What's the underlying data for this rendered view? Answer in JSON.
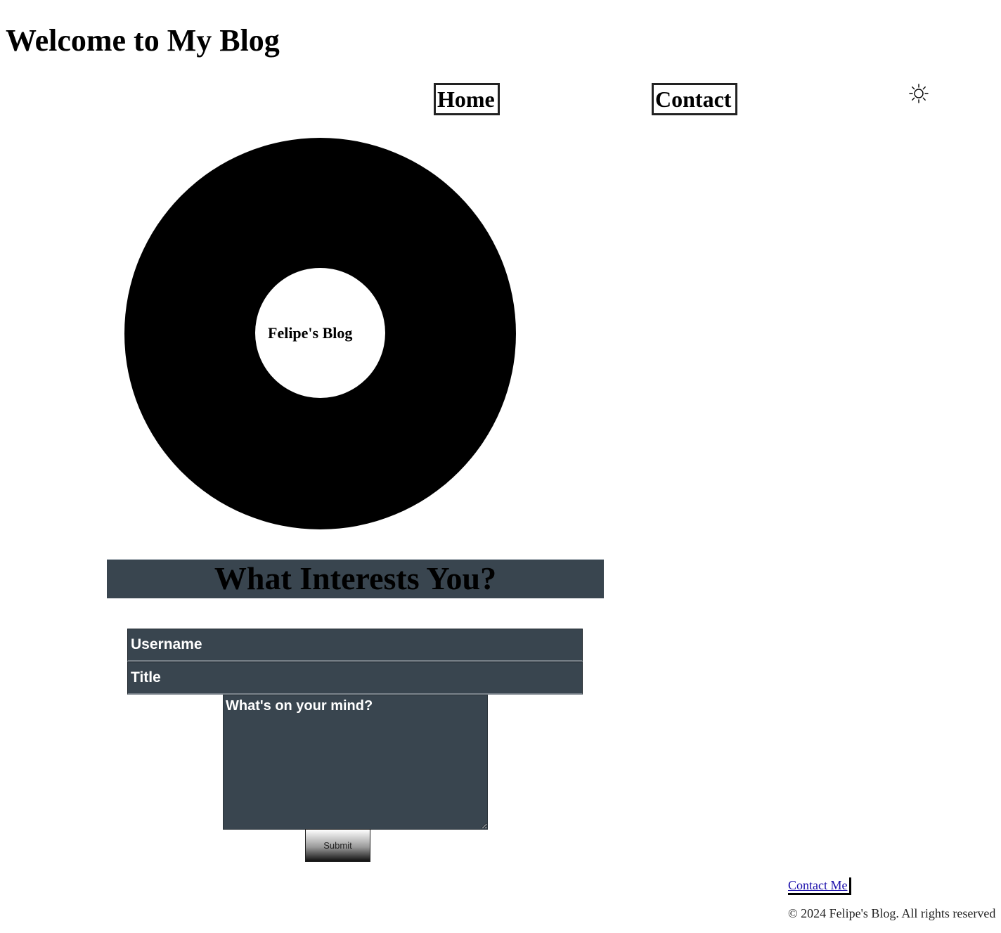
{
  "header": {
    "title": "Welcome to My Blog"
  },
  "nav": {
    "items": [
      {
        "label": "Home"
      },
      {
        "label": "Contact"
      }
    ],
    "theme_toggle_icon": "sun-icon"
  },
  "logo": {
    "text": "Felipe's Blog",
    "ring_color": "#000000"
  },
  "interests": {
    "heading": "What Interests You?",
    "banner_color": "#39454f"
  },
  "form": {
    "username_placeholder": "Username",
    "title_placeholder": "Title",
    "body_placeholder": "What's on your mind?",
    "submit_label": "Submit"
  },
  "footer": {
    "contact_label": "Contact Me",
    "copyright": "© 2024 Felipe's Blog. All rights reserved"
  }
}
